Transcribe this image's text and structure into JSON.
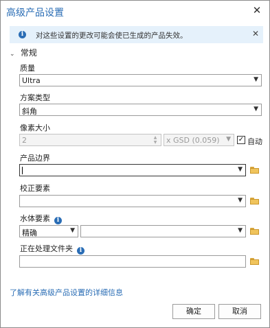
{
  "dialog": {
    "title": "高级产品设置",
    "close_glyph": "✕"
  },
  "banner": {
    "text": "对这些设置的更改可能会使已生成的产品失效。",
    "close_glyph": "✕",
    "icon_glyph": "i"
  },
  "section": {
    "label": "常规",
    "chevron": "⌄"
  },
  "quality": {
    "label": "质量",
    "value": "Ultra"
  },
  "scheme_type": {
    "label": "方案类型",
    "value": "斜角"
  },
  "pixel_size": {
    "label": "像素大小",
    "value": "2",
    "unit_value": "x GSD (0.059)",
    "auto_label": "自动",
    "auto_checked": true
  },
  "product_boundary": {
    "label": "产品边界",
    "value": ""
  },
  "correction_features": {
    "label": "校正要素",
    "value": ""
  },
  "water_features": {
    "label": "水体要素",
    "mode_value": "精确",
    "value": ""
  },
  "processing_folder": {
    "label": "正在处理文件夹",
    "value": ""
  },
  "help_link": "了解有关高级产品设置的详细信息",
  "buttons": {
    "ok": "确定",
    "cancel": "取消"
  },
  "colors": {
    "accent": "#2a6db5",
    "banner_bg": "#e5f1fb",
    "folder": "#f0c45c"
  },
  "icons": {
    "dropdown": "chevron-down-icon",
    "folder": "folder-icon",
    "info": "info-icon",
    "close": "close-icon"
  }
}
